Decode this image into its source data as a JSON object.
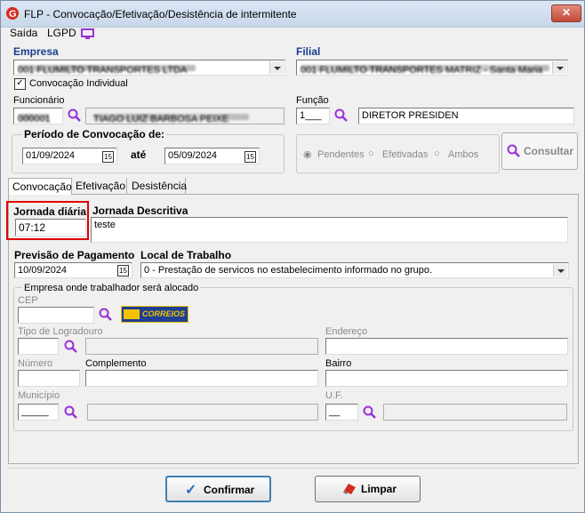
{
  "window": {
    "title": "FLP - Convocação/Efetivação/Desistência de intermitente",
    "close_glyph": "✕"
  },
  "menu": {
    "saida": "Saída",
    "lgpd": "LGPD"
  },
  "empresa": {
    "label": "Empresa",
    "value": "001 FLUMILTO TRANSPORTES LTDA"
  },
  "filial": {
    "label": "Filial",
    "value": "001 FLUMILTO TRANSPORTES MATRIZ - Santa Maria"
  },
  "convocacao_individual": {
    "label": "Convocação Individual",
    "checked": true
  },
  "funcionario": {
    "label": "Funcionário",
    "code": "000001",
    "name": "TIAGO LUIZ BARBOSA PEIXE"
  },
  "funcao": {
    "label": "Função",
    "code": "1___",
    "name": "DIRETOR PRESIDEN"
  },
  "periodo": {
    "label": "Período de Convocação de:",
    "de": "01/09/2024",
    "ate_label": "até",
    "ate": "05/09/2024"
  },
  "status": {
    "pendentes": "Pendentes",
    "efetivadas": "Efetivadas",
    "ambos": "Ambos",
    "selected": "Pendentes"
  },
  "consultar": {
    "label": "Consultar"
  },
  "tabs": [
    {
      "label": "Convocação"
    },
    {
      "label": "Efetivação"
    },
    {
      "label": "Desistência"
    }
  ],
  "jornada": {
    "label": "Jornada diária",
    "value": "07:12",
    "descritiva_label": "Jornada Descritiva",
    "descritiva_value": "teste"
  },
  "previsao": {
    "label": "Previsão de Pagamento",
    "value": "10/09/2024"
  },
  "local": {
    "label": "Local de Trabalho",
    "value": "0 - Prestação de servicos no estabelecimento informado no grupo."
  },
  "alocado": {
    "group_label": "Empresa onde trabalhador será alocado",
    "cep": "CEP",
    "correios": "CORREIOS",
    "tipo_logradouro": "Tipo de Logradouro",
    "endereco": "Endereço",
    "numero": "Número",
    "complemento": "Complemento",
    "bairro": "Bairro",
    "municipio": "Município",
    "municipio_code": "_____",
    "uf": "U.F.",
    "uf_code": "__"
  },
  "buttons": {
    "confirmar": "Confirmar",
    "limpar": "Limpar"
  },
  "colors": {
    "highlight": "#e00000",
    "accent": "#8a2be2",
    "title_bg": "#c8d7ea"
  }
}
